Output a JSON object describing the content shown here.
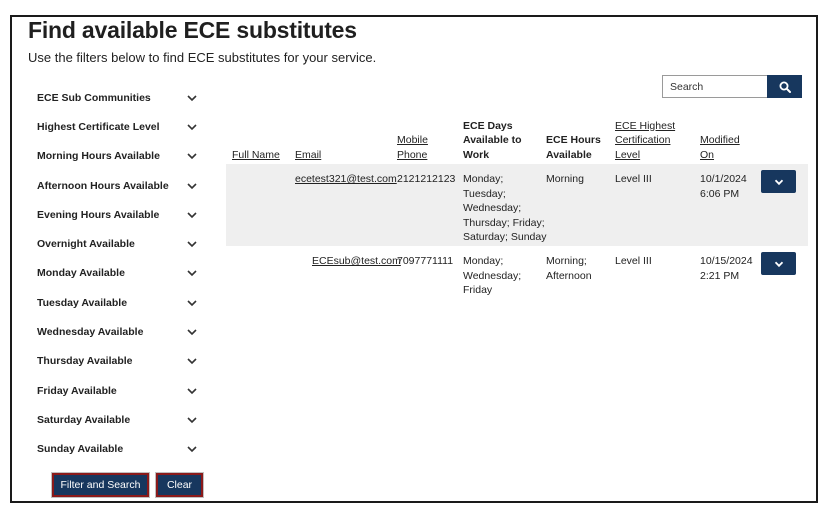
{
  "page": {
    "title": "Find available ECE substitutes",
    "subtitle": "Use the filters below to find ECE substitutes for your service."
  },
  "filters": [
    {
      "label": "ECE Sub Communities"
    },
    {
      "label": "Highest Certificate Level"
    },
    {
      "label": "Morning Hours Available"
    },
    {
      "label": "Afternoon Hours Available"
    },
    {
      "label": "Evening Hours Available"
    },
    {
      "label": "Overnight Available"
    },
    {
      "label": "Monday Available"
    },
    {
      "label": "Tuesday Available"
    },
    {
      "label": "Wednesday Available"
    },
    {
      "label": "Thursday Available"
    },
    {
      "label": "Friday Available"
    },
    {
      "label": "Saturday Available"
    },
    {
      "label": "Sunday Available"
    }
  ],
  "buttons": {
    "filter_search": "Filter and Search",
    "clear": "Clear"
  },
  "search": {
    "placeholder": "Search",
    "icon": "search-icon"
  },
  "table": {
    "headers": {
      "full_name": "Full Name",
      "email": "Email",
      "mobile_phone_1": "Mobile",
      "mobile_phone_2": "Phone",
      "days_1": "ECE Days",
      "days_2": "Available to",
      "days_3": "Work",
      "hours_1": "ECE Hours",
      "hours_2": "Available",
      "cert_1": "ECE Highest",
      "cert_2": "Certification",
      "cert_3": "Level",
      "modified_1": "Modified",
      "modified_2": "On"
    },
    "rows": [
      {
        "full_name": "",
        "email": "ecetest321@test.com",
        "phone": "2121212123",
        "days_1": "Monday;",
        "days_2": "Tuesday;",
        "days_3": "Wednesday;",
        "days_4": "Thursday; Friday;",
        "days_5": "Saturday; Sunday",
        "hours_1": "Morning",
        "hours_2": "",
        "cert": "Level III",
        "modified_date": "10/1/2024",
        "modified_time": "6:06 PM"
      },
      {
        "full_name": "",
        "email": "ECEsub@test.com",
        "phone": "7097771111",
        "days_1": "Monday;",
        "days_2": "Wednesday;",
        "days_3": "Friday",
        "days_4": "",
        "days_5": "",
        "hours_1": "Morning;",
        "hours_2": "Afternoon",
        "cert": "Level III",
        "modified_date": "10/15/2024",
        "modified_time": "2:21 PM"
      }
    ]
  },
  "colors": {
    "primary": "#17375e",
    "button_border": "#8b1a1a",
    "row_shade": "#efefef"
  }
}
